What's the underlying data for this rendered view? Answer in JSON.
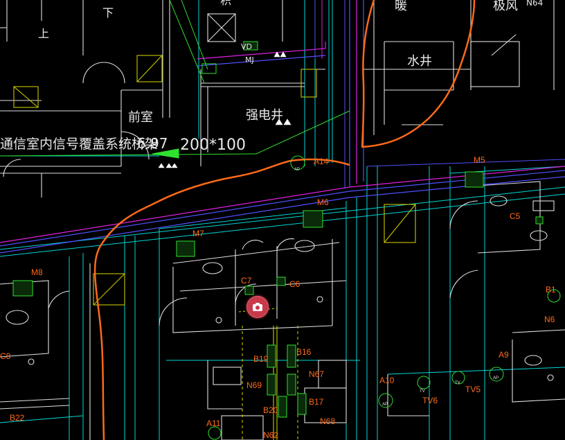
{
  "drawing": {
    "rooms": {
      "up": "上",
      "down": "下",
      "antechamber": "前室",
      "strong_shaft": "强电井",
      "water_well": "水井",
      "top_partial_1": "暖",
      "top_partial_2": "积",
      "top_partial_3": "极风"
    },
    "tray": {
      "title": "通信室内信号覆盖系统桥架",
      "elevation": "6.97",
      "size": "200*100"
    },
    "equipment": {
      "vd": "VD",
      "mj": "MJ",
      "top_n": "N64",
      "a14": "A14",
      "m5": "M5",
      "m6": "M6",
      "m7": "M7",
      "m8": "M8",
      "c5": "C5",
      "c6": "C6",
      "c7": "C7",
      "c8": "C8",
      "b1": "B1",
      "b16": "B16",
      "b17": "B17",
      "b19": "B19",
      "b20": "B20",
      "b22": "B22",
      "n67": "N67",
      "n68": "N68",
      "n6": "N6",
      "n69": "N69",
      "n62": "N62",
      "a9": "A9",
      "a10": "A10",
      "a11": "A11",
      "tv5": "TV5",
      "tv6": "TV6",
      "ap": "AP",
      "tv": "TV"
    },
    "colors": {
      "background": "#000000",
      "cable_route": "#ff6a1a",
      "walls": "#e8e8e8",
      "cyan_lines": "#00e0e0",
      "magenta_tray": "#e020e0",
      "blue_tray": "#4040ff",
      "green_devices": "#30e030",
      "yellow_lines": "#c8c800"
    }
  },
  "toolbar": {
    "camera_icon": "camera-icon"
  }
}
